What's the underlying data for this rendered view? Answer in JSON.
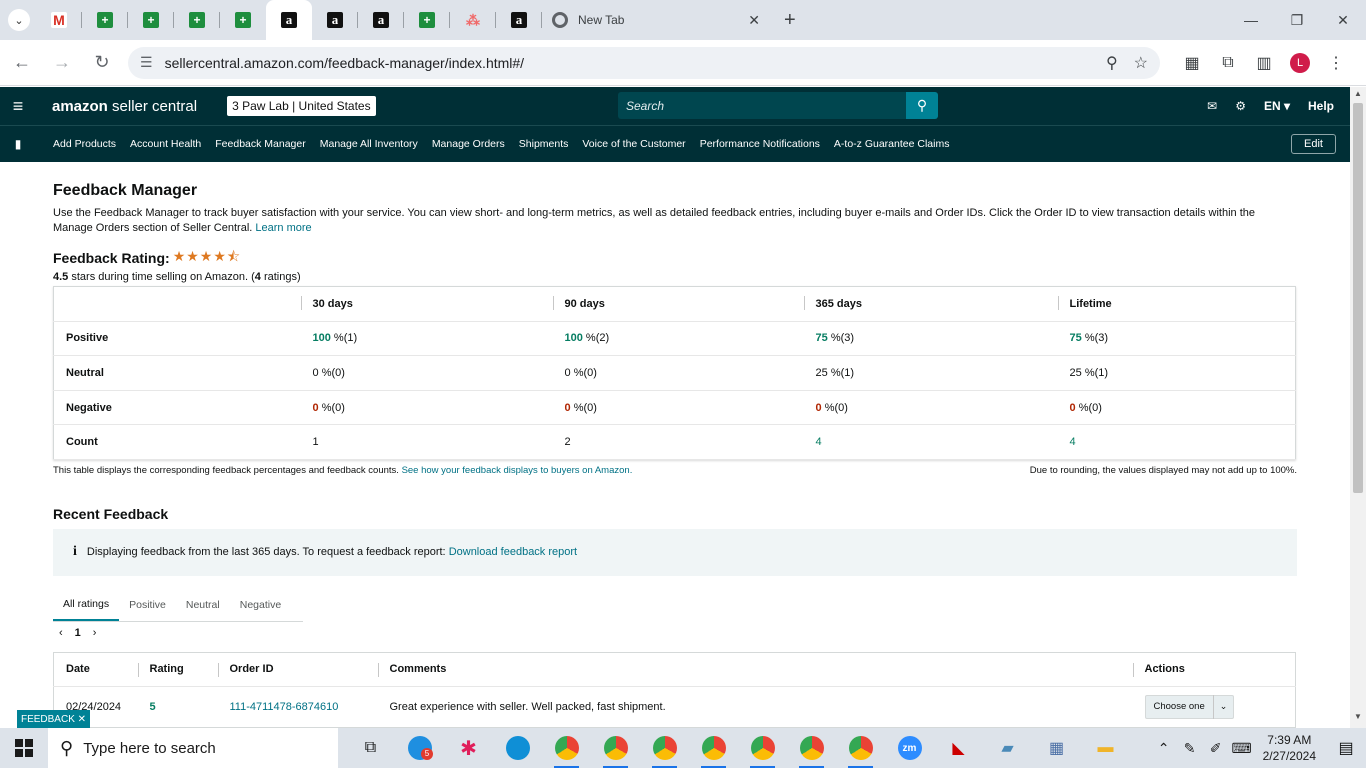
{
  "browser": {
    "tabs": [
      {
        "icon": "gmail-icon",
        "glyph": "M"
      },
      {
        "icon": "sheets-icon",
        "glyph": "+"
      },
      {
        "icon": "sheets-icon",
        "glyph": "+"
      },
      {
        "icon": "sheets-icon",
        "glyph": "+"
      },
      {
        "icon": "sheets-icon",
        "glyph": "+"
      },
      {
        "icon": "amazon-icon",
        "glyph": "a"
      },
      {
        "icon": "amazon-icon",
        "glyph": "a"
      },
      {
        "icon": "amazon-icon",
        "glyph": "a"
      },
      {
        "icon": "sheets-icon",
        "glyph": "+"
      },
      {
        "icon": "asana-icon",
        "glyph": "⁂"
      },
      {
        "icon": "amazon-icon",
        "glyph": "a"
      }
    ],
    "active_tab_index": 5,
    "new_tab_title": "New Tab",
    "url": "sellercentral.amazon.com/feedback-manager/index.html#/",
    "profile_initial": "L"
  },
  "header": {
    "logo_bold": "amazon",
    "logo_rest": " seller central",
    "store": "3 Paw Lab | United States",
    "search_placeholder": "Search",
    "language": "EN",
    "help": "Help"
  },
  "nav": {
    "items": [
      "Add Products",
      "Account Health",
      "Feedback Manager",
      "Manage All Inventory",
      "Manage Orders",
      "Shipments",
      "Voice of the Customer",
      "Performance Notifications",
      "A-to-z Guarantee Claims"
    ],
    "edit": "Edit"
  },
  "page": {
    "title": "Feedback Manager",
    "description": "Use the Feedback Manager to track buyer satisfaction with your service. You can view short- and long-term metrics, as well as detailed feedback entries, including buyer e-mails and Order IDs. Click the Order ID to view transaction details within the Manage Orders section of Seller Central.",
    "learn_more": "Learn more",
    "rating_title": "Feedback Rating:",
    "rating_stars": 4.5,
    "rating_value": "4.5",
    "rating_text": "stars during time selling on Amazon. (",
    "rating_count": "4",
    "rating_suffix": " ratings)"
  },
  "summary_table": {
    "columns": [
      "30 days",
      "90 days",
      "365 days",
      "Lifetime"
    ],
    "rows": [
      {
        "label": "Positive",
        "cells": [
          {
            "n": "100",
            "r": "%(1)"
          },
          {
            "n": "100",
            "r": "%(2)"
          },
          {
            "n": "75",
            "r": "%(3)"
          },
          {
            "n": "75",
            "r": "%(3)"
          }
        ],
        "style": "green"
      },
      {
        "label": "Neutral",
        "cells": [
          {
            "n": "0",
            "r": "%(0)"
          },
          {
            "n": "0",
            "r": "%(0)"
          },
          {
            "n": "25",
            "r": "%(1)"
          },
          {
            "n": "25",
            "r": "%(1)"
          }
        ],
        "style": "plain"
      },
      {
        "label": "Negative",
        "cells": [
          {
            "n": "0",
            "r": "%(0)"
          },
          {
            "n": "0",
            "r": "%(0)"
          },
          {
            "n": "0",
            "r": "%(0)"
          },
          {
            "n": "0",
            "r": "%(0)"
          }
        ],
        "style": "red"
      },
      {
        "label": "Count",
        "cells": [
          {
            "n": "1",
            "r": ""
          },
          {
            "n": "2",
            "r": ""
          },
          {
            "n": "4",
            "r": ""
          },
          {
            "n": "4",
            "r": ""
          }
        ],
        "style": "count"
      }
    ],
    "note_left": "This table displays the corresponding feedback percentages and feedback counts.",
    "note_link": "See how your feedback displays to buyers on Amazon.",
    "note_right": "Due to rounding, the values displayed may not add up to 100%."
  },
  "recent": {
    "title": "Recent Feedback",
    "info": "Displaying feedback from the last 365 days. To request a feedback report:",
    "info_link": "Download feedback report",
    "tabs": [
      "All ratings",
      "Positive",
      "Neutral",
      "Negative"
    ],
    "page": "1",
    "columns": [
      "Date",
      "Rating",
      "Order ID",
      "Comments",
      "Actions"
    ],
    "rows": [
      {
        "date": "02/24/2024",
        "rating": "5",
        "order_id": "111-4711478-6874610",
        "comment": "Great experience with seller. Well packed, fast shipment.",
        "action": "Choose one"
      }
    ]
  },
  "feedback_tag": "FEEDBACK ✕",
  "taskbar": {
    "search_placeholder": "Type here to search",
    "time": "7:39 AM",
    "date": "2/27/2024",
    "badge": "5"
  },
  "colors": {
    "header_bg": "#002f36",
    "accent": "#008296",
    "positive": "#067d62",
    "negative": "#b12704",
    "star": "#de7921"
  }
}
